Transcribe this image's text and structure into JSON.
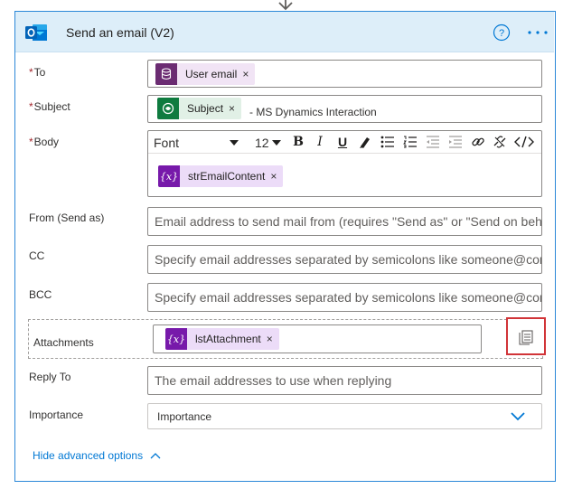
{
  "card": {
    "title": "Send an email (V2)",
    "icons": {
      "logo": "outlook-logo",
      "help": "help-circle-icon",
      "more": "more-ellipsis-icon",
      "flow": "arrow-down-icon"
    }
  },
  "fields": {
    "to": {
      "required_marker": "*",
      "label": "To",
      "token": {
        "label": "User email",
        "icon": "database-icon",
        "remove": "×"
      }
    },
    "subject": {
      "required_marker": "*",
      "label": "Subject",
      "token": {
        "label": "Subject",
        "icon": "dynamics-icon",
        "remove": "×"
      },
      "suffix": "- MS Dynamics Interaction"
    },
    "body": {
      "required_marker": "*",
      "label": "Body",
      "toolbar": {
        "font": "Font",
        "size": "12",
        "bold": "B",
        "italic": "I",
        "underline": "U"
      },
      "token": {
        "label": "strEmailContent",
        "icon": "variable-icon",
        "icon_text": "{x}",
        "remove": "×"
      }
    },
    "from": {
      "label": "From (Send as)",
      "placeholder": "Email address to send mail from (requires \"Send as\" or \"Send on beh"
    },
    "cc": {
      "label": "CC",
      "placeholder": "Specify email addresses separated by semicolons like someone@con"
    },
    "bcc": {
      "label": "BCC",
      "placeholder": "Specify email addresses separated by semicolons like someone@con"
    },
    "attachments": {
      "label": "Attachments",
      "token": {
        "label": "lstAttachment",
        "icon": "variable-icon",
        "icon_text": "{x}",
        "remove": "×"
      }
    },
    "reply_to": {
      "label": "Reply To",
      "placeholder": "The email addresses to use when replying"
    },
    "importance": {
      "label": "Importance",
      "value": "Importance"
    }
  },
  "footer": {
    "hide_advanced": "Hide advanced options"
  },
  "colors": {
    "accent": "#0078d4",
    "border_active": "#2b88d8",
    "header_bg": "#ddeef9",
    "required": "#a4262c",
    "highlight": "#d13438",
    "variable_token": "#7719aa"
  }
}
